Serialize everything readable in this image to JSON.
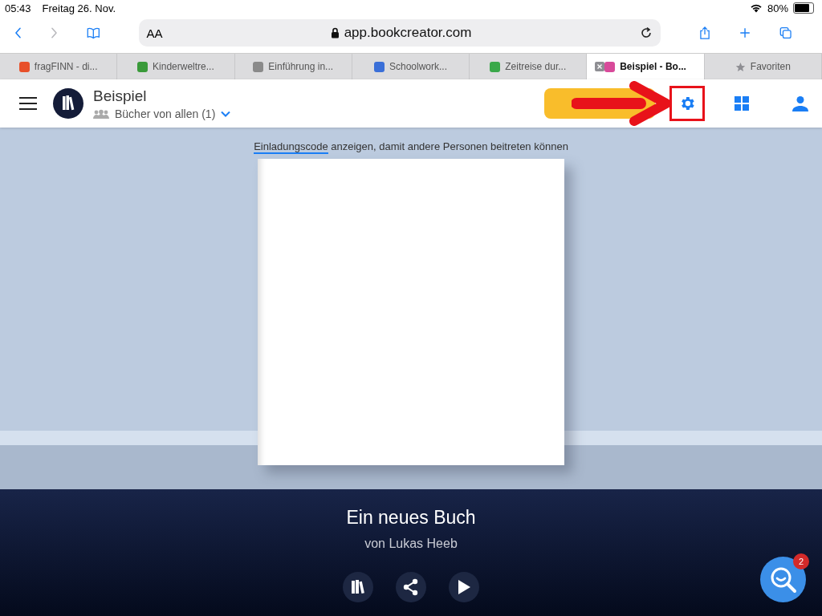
{
  "status_bar": {
    "time": "05:43",
    "date": "Freitag 26. Nov.",
    "battery": "80%"
  },
  "browser": {
    "text_size": "AA",
    "address": "app.bookcreator.com"
  },
  "tabs": [
    {
      "label": "fragFINN - di...",
      "selected": false,
      "kind": "site",
      "color": "#e8502a"
    },
    {
      "label": "Kinderweltre...",
      "selected": false,
      "kind": "site",
      "color": "#3a9a3a"
    },
    {
      "label": "Einführung in...",
      "selected": false,
      "kind": "site",
      "color": "#8a8a8a"
    },
    {
      "label": "Schoolwork...",
      "selected": false,
      "kind": "site",
      "color": "#3a6fd8"
    },
    {
      "label": "Zeitreise dur...",
      "selected": false,
      "kind": "site",
      "color": "#3aa84a"
    },
    {
      "label": "Beispiel - Bo...",
      "selected": true,
      "kind": "site",
      "color": "#d84a9a"
    },
    {
      "label": "Favoriten",
      "selected": false,
      "kind": "star"
    }
  ],
  "header": {
    "title": "Beispiel",
    "subtitle": "Bücher von allen (1)"
  },
  "notice": {
    "link": "Einladungscode",
    "text": "anzeigen, damit andere Personen beitreten können"
  },
  "book": {
    "title": "Ein neues Buch",
    "author": "von Lukas Heeb"
  },
  "help": {
    "badge": "2"
  }
}
